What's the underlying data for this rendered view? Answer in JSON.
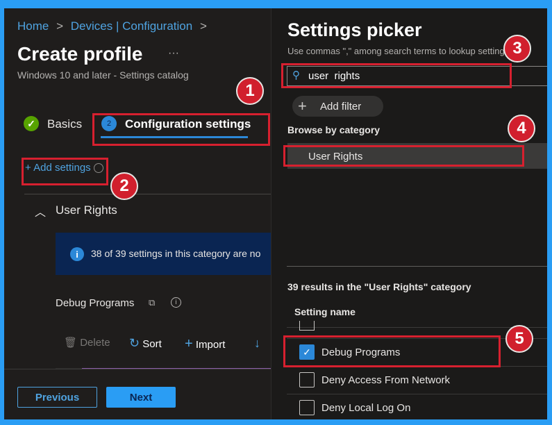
{
  "breadcrumb": {
    "items": [
      "Home",
      "Devices | Configuration"
    ],
    "separator": ">"
  },
  "page": {
    "title": "Create profile",
    "more": "···",
    "subtitle": "Windows 10 and later - Settings catalog"
  },
  "tabs": [
    {
      "label": "Basics",
      "status": "complete"
    },
    {
      "label": "Configuration settings",
      "number": "2",
      "active": true
    }
  ],
  "add_settings": {
    "plus": "+",
    "label": "Add settings"
  },
  "category": {
    "label": "User Rights",
    "expanded": true
  },
  "info_banner": {
    "text": "38 of 39 settings in this category are no"
  },
  "setting": {
    "label": "Debug Programs"
  },
  "toolbar": {
    "delete": "Delete",
    "sort": "Sort",
    "import": "Import"
  },
  "footer": {
    "previous": "Previous",
    "next": "Next"
  },
  "picker": {
    "title": "Settings picker",
    "hint": "Use commas \",\" among search terms to lookup settings b",
    "search_value": "user  rights",
    "add_filter": "Add filter",
    "browse_heading": "Browse by category",
    "categories": [
      "User Rights"
    ],
    "results_heading": "39 results in the \"User Rights\" category",
    "column_header": "Setting name",
    "results": [
      {
        "label": "Debug Programs",
        "checked": true
      },
      {
        "label": "Deny Access From Network",
        "checked": false
      },
      {
        "label": "Deny Local Log On",
        "checked": false
      }
    ]
  },
  "annotations": [
    "1",
    "2",
    "3",
    "4",
    "5"
  ],
  "colors": {
    "accent": "#2b88d8",
    "annotation_red": "#d11f2d",
    "frame": "#2a9df4",
    "success": "#57a300"
  }
}
